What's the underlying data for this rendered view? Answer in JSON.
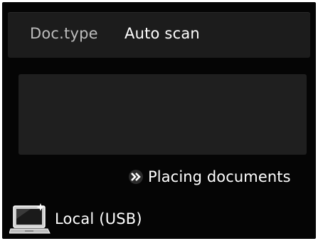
{
  "doc_type": {
    "label": "Doc.type",
    "value": "Auto scan"
  },
  "preview": {
    "text": ""
  },
  "placing_link": {
    "label": "Placing documents",
    "icon": "double-chevron-right-icon"
  },
  "destination": {
    "label": "Local (USB)",
    "icon": "computer-icon"
  },
  "colors": {
    "screen_bg": "#050505",
    "bar_bg": "#1c1c1c",
    "preview_bg": "#1f1f1f",
    "label_text": "#bdbdbd",
    "value_text": "#ffffff"
  }
}
